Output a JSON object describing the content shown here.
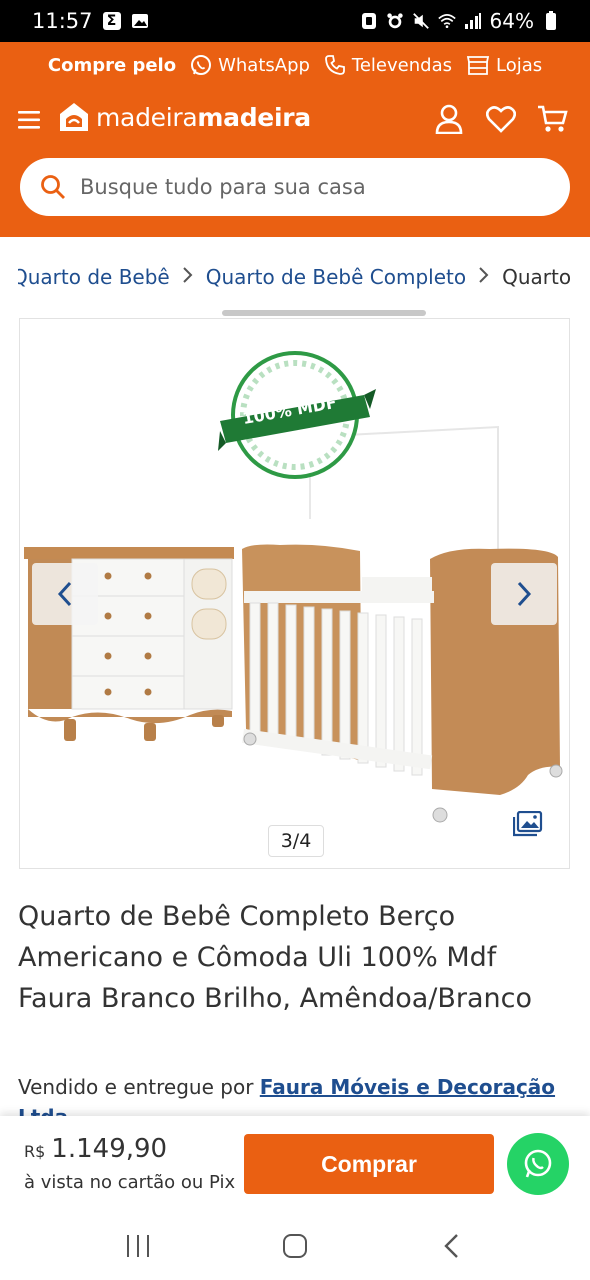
{
  "status_bar": {
    "time": "11:57",
    "battery": "64%",
    "left_icons": [
      "sigma-app-icon",
      "gallery-app-icon"
    ],
    "right_icons": [
      "nfc-icon",
      "alarm-icon",
      "mute-icon",
      "wifi-icon",
      "signal-icon",
      "battery-icon"
    ]
  },
  "header": {
    "contact_prefix": "Compre pelo",
    "whatsapp_label": "WhatsApp",
    "televendas_label": "Televendas",
    "lojas_label": "Lojas",
    "logo_text_light": "madeira",
    "logo_text_bold": "madeira",
    "search_placeholder": "Busque tudo para sua casa"
  },
  "breadcrumb": {
    "items": [
      "Quarto de Bebê",
      "Quarto de Bebê Completo",
      "Quarto"
    ]
  },
  "gallery": {
    "counter": "3/4",
    "badge_text": "100% MDF"
  },
  "product": {
    "title": "Quarto de Bebê Completo Berço Americano e Cômoda Uli 100% Mdf Faura Branco Brilho, Amêndoa/Branco",
    "seller_prefix": "Vendido e entregue por ",
    "seller_name": "Faura Móveis e Decoração Ltda"
  },
  "buy_bar": {
    "currency": "R$",
    "price": "1.149,90",
    "price_note": "à vista no cartão ou Pix",
    "buy_label": "Comprar"
  },
  "colors": {
    "brand_orange": "#ea6012",
    "link_blue": "#1f4e8f",
    "whatsapp_green": "#25d366"
  }
}
